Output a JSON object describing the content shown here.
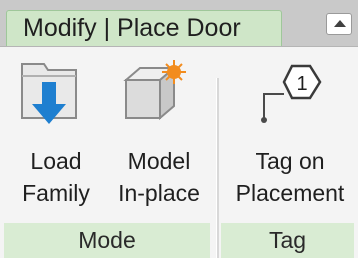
{
  "ribbon": {
    "tab_title": "Modify | Place Door"
  },
  "panels": [
    {
      "label": "Mode",
      "tools": [
        {
          "line1": "Load",
          "line2": "Family"
        },
        {
          "line1": "Model",
          "line2": "In-place"
        }
      ]
    },
    {
      "label": "Tag",
      "tools": [
        {
          "line1": "Tag on",
          "line2": "Placement",
          "icon_text": "1"
        }
      ]
    }
  ],
  "colors": {
    "context_tab": "#cfe6c8",
    "panel_label": "#d9ecd3",
    "accent_blue": "#1e7fd0",
    "accent_orange": "#f28c1e"
  }
}
